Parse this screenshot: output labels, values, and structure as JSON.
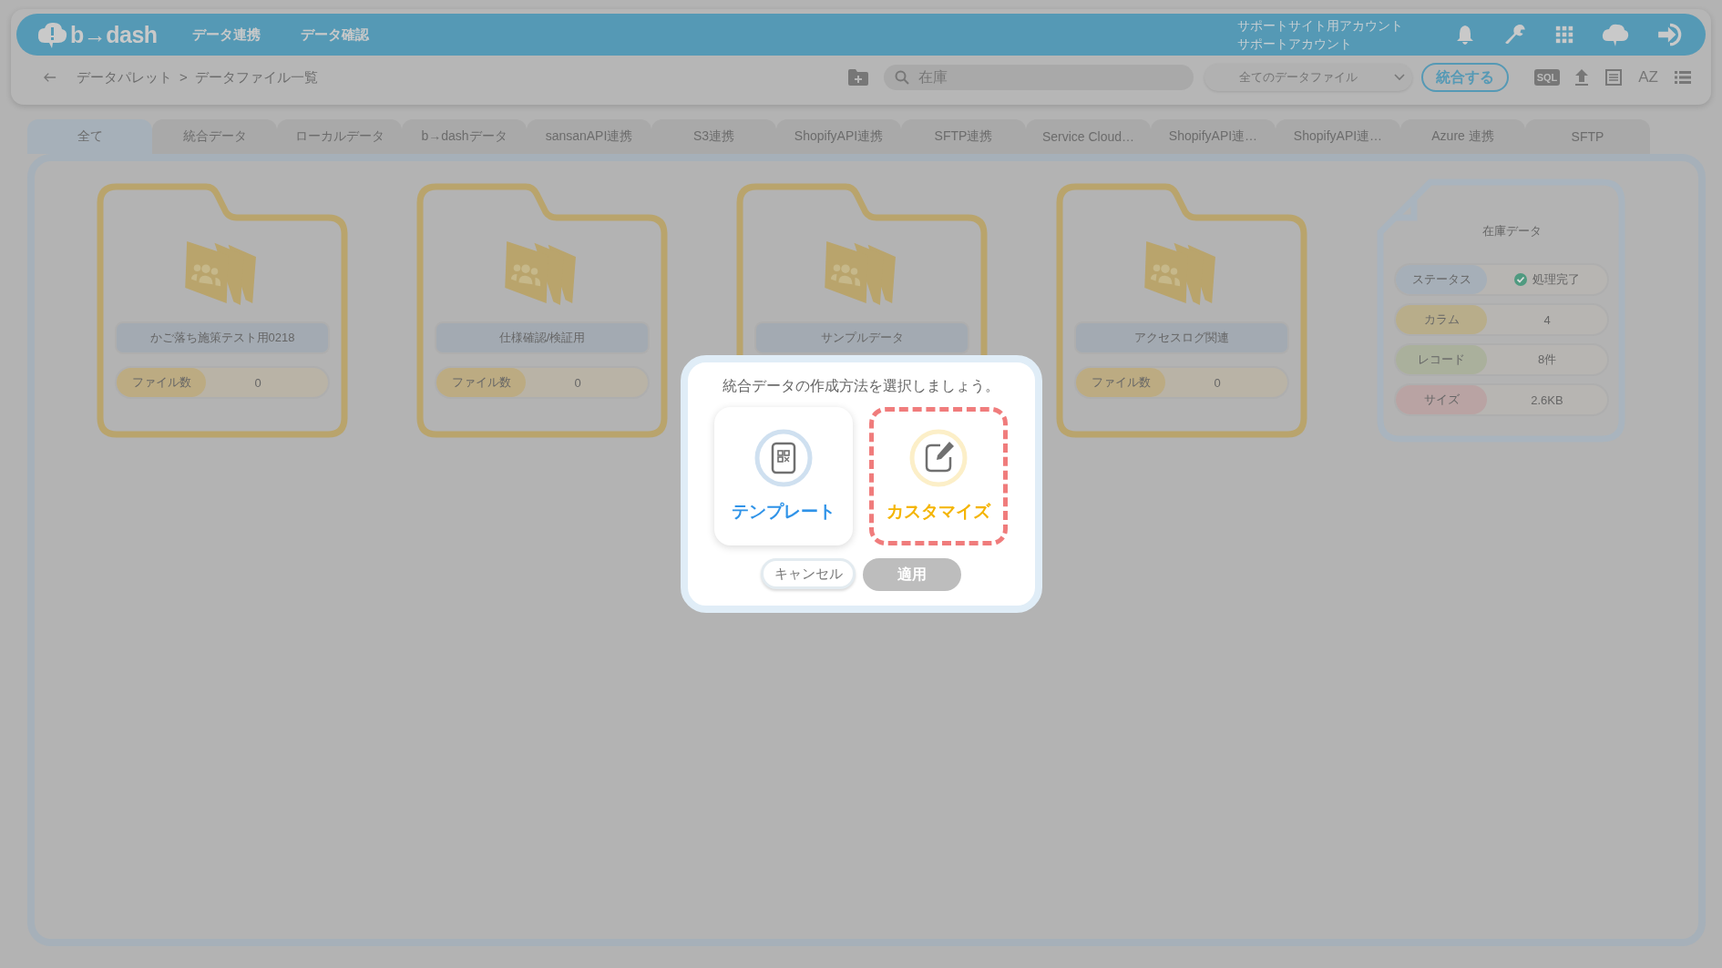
{
  "header": {
    "logo": "b→dash",
    "nav": [
      "データ連携",
      "データ確認"
    ],
    "account": [
      "サポートサイト用アカウント",
      "サポートアカウント"
    ]
  },
  "toolbar": {
    "breadcrumb": [
      "データパレット",
      ">",
      "データファイル一覧"
    ],
    "search": {
      "value": "在庫"
    },
    "filter": {
      "value": "全てのデータファイル"
    },
    "merge_button": "統合する",
    "sql_label": "SQL",
    "sort_label": "AZ"
  },
  "tabs": [
    {
      "label": "全て",
      "selected": true
    },
    {
      "label": "統合データ",
      "selected": false
    },
    {
      "label": "ローカルデータ",
      "selected": false
    },
    {
      "label": "b→dashデータ",
      "selected": false
    },
    {
      "label": "sansanAPI連携",
      "selected": false
    },
    {
      "label": "S3連携",
      "selected": false
    },
    {
      "label": "ShopifyAPI連携",
      "selected": false
    },
    {
      "label": "SFTP連携",
      "selected": false
    },
    {
      "label": "Service Cloud…",
      "selected": false
    },
    {
      "label": "ShopifyAPI連…",
      "selected": false
    },
    {
      "label": "ShopifyAPI連…",
      "selected": false
    },
    {
      "label": "Azure 連携",
      "selected": false
    },
    {
      "label": "SFTP",
      "selected": false
    }
  ],
  "folders": [
    {
      "name": "かご落ち施策テスト用0218",
      "count_label": "ファイル数",
      "count": "0"
    },
    {
      "name": "仕様確認/検証用",
      "count_label": "ファイル数",
      "count": "0"
    },
    {
      "name": "サンプルデータ"
    },
    {
      "name": "アクセスログ関連",
      "count_label": "ファイル数",
      "count": "0"
    }
  ],
  "file_card": {
    "title": "在庫データ",
    "rows": [
      {
        "kind": "status",
        "label": "ステータス",
        "value": "処理完了",
        "color": "#a6afb8"
      },
      {
        "kind": "plain",
        "label": "カラム",
        "value": "4",
        "color": "#b8ad8a"
      },
      {
        "kind": "plain",
        "label": "レコード",
        "value": "8件",
        "color": "#aab09c"
      },
      {
        "kind": "plain",
        "label": "サイズ",
        "value": "2.6KB",
        "color": "#b9a3a3"
      }
    ]
  },
  "dialog": {
    "prompt": "統合データの作成方法を選択しましょう。",
    "options": [
      {
        "kind": "template",
        "label": "テンプレート",
        "selected": false
      },
      {
        "kind": "custom",
        "label": "カスタマイズ",
        "selected": true
      }
    ],
    "cancel": "キャンセル",
    "apply": {
      "label": "適用",
      "disabled": true
    }
  }
}
